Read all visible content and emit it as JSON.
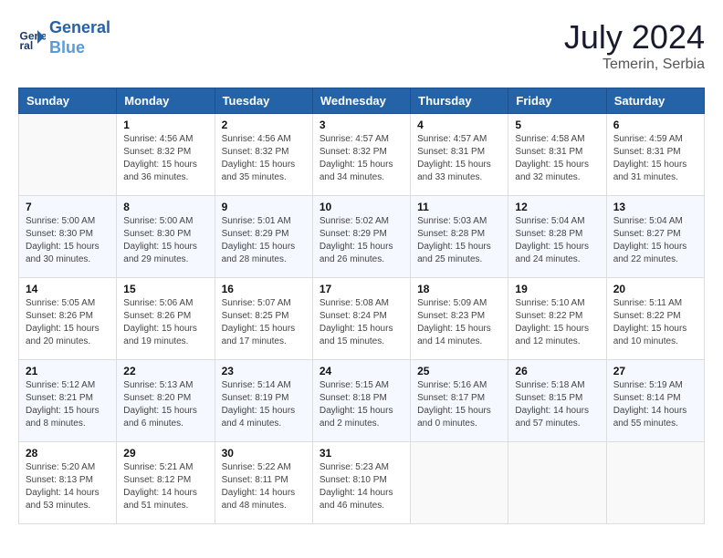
{
  "header": {
    "logo_line1": "General",
    "logo_line2": "Blue",
    "title": "July 2024",
    "subtitle": "Temerin, Serbia"
  },
  "weekdays": [
    "Sunday",
    "Monday",
    "Tuesday",
    "Wednesday",
    "Thursday",
    "Friday",
    "Saturday"
  ],
  "weeks": [
    [
      {
        "day": "",
        "info": ""
      },
      {
        "day": "1",
        "info": "Sunrise: 4:56 AM\nSunset: 8:32 PM\nDaylight: 15 hours\nand 36 minutes."
      },
      {
        "day": "2",
        "info": "Sunrise: 4:56 AM\nSunset: 8:32 PM\nDaylight: 15 hours\nand 35 minutes."
      },
      {
        "day": "3",
        "info": "Sunrise: 4:57 AM\nSunset: 8:32 PM\nDaylight: 15 hours\nand 34 minutes."
      },
      {
        "day": "4",
        "info": "Sunrise: 4:57 AM\nSunset: 8:31 PM\nDaylight: 15 hours\nand 33 minutes."
      },
      {
        "day": "5",
        "info": "Sunrise: 4:58 AM\nSunset: 8:31 PM\nDaylight: 15 hours\nand 32 minutes."
      },
      {
        "day": "6",
        "info": "Sunrise: 4:59 AM\nSunset: 8:31 PM\nDaylight: 15 hours\nand 31 minutes."
      }
    ],
    [
      {
        "day": "7",
        "info": ""
      },
      {
        "day": "8",
        "info": "Sunrise: 5:00 AM\nSunset: 8:30 PM\nDaylight: 15 hours\nand 29 minutes."
      },
      {
        "day": "9",
        "info": "Sunrise: 5:01 AM\nSunset: 8:29 PM\nDaylight: 15 hours\nand 28 minutes."
      },
      {
        "day": "10",
        "info": "Sunrise: 5:02 AM\nSunset: 8:29 PM\nDaylight: 15 hours\nand 26 minutes."
      },
      {
        "day": "11",
        "info": "Sunrise: 5:03 AM\nSunset: 8:28 PM\nDaylight: 15 hours\nand 25 minutes."
      },
      {
        "day": "12",
        "info": "Sunrise: 5:04 AM\nSunset: 8:28 PM\nDaylight: 15 hours\nand 24 minutes."
      },
      {
        "day": "13",
        "info": "Sunrise: 5:04 AM\nSunset: 8:27 PM\nDaylight: 15 hours\nand 22 minutes."
      }
    ],
    [
      {
        "day": "14",
        "info": ""
      },
      {
        "day": "15",
        "info": "Sunrise: 5:06 AM\nSunset: 8:26 PM\nDaylight: 15 hours\nand 19 minutes."
      },
      {
        "day": "16",
        "info": "Sunrise: 5:07 AM\nSunset: 8:25 PM\nDaylight: 15 hours\nand 17 minutes."
      },
      {
        "day": "17",
        "info": "Sunrise: 5:08 AM\nSunset: 8:24 PM\nDaylight: 15 hours\nand 15 minutes."
      },
      {
        "day": "18",
        "info": "Sunrise: 5:09 AM\nSunset: 8:23 PM\nDaylight: 15 hours\nand 14 minutes."
      },
      {
        "day": "19",
        "info": "Sunrise: 5:10 AM\nSunset: 8:22 PM\nDaylight: 15 hours\nand 12 minutes."
      },
      {
        "day": "20",
        "info": "Sunrise: 5:11 AM\nSunset: 8:22 PM\nDaylight: 15 hours\nand 10 minutes."
      }
    ],
    [
      {
        "day": "21",
        "info": ""
      },
      {
        "day": "22",
        "info": "Sunrise: 5:13 AM\nSunset: 8:20 PM\nDaylight: 15 hours\nand 6 minutes."
      },
      {
        "day": "23",
        "info": "Sunrise: 5:14 AM\nSunset: 8:19 PM\nDaylight: 15 hours\nand 4 minutes."
      },
      {
        "day": "24",
        "info": "Sunrise: 5:15 AM\nSunset: 8:18 PM\nDaylight: 15 hours\nand 2 minutes."
      },
      {
        "day": "25",
        "info": "Sunrise: 5:16 AM\nSunset: 8:17 PM\nDaylight: 15 hours\nand 0 minutes."
      },
      {
        "day": "26",
        "info": "Sunrise: 5:18 AM\nSunset: 8:15 PM\nDaylight: 14 hours\nand 57 minutes."
      },
      {
        "day": "27",
        "info": "Sunrise: 5:19 AM\nSunset: 8:14 PM\nDaylight: 14 hours\nand 55 minutes."
      }
    ],
    [
      {
        "day": "28",
        "info": "Sunrise: 5:20 AM\nSunset: 8:13 PM\nDaylight: 14 hours\nand 53 minutes."
      },
      {
        "day": "29",
        "info": "Sunrise: 5:21 AM\nSunset: 8:12 PM\nDaylight: 14 hours\nand 51 minutes."
      },
      {
        "day": "30",
        "info": "Sunrise: 5:22 AM\nSunset: 8:11 PM\nDaylight: 14 hours\nand 48 minutes."
      },
      {
        "day": "31",
        "info": "Sunrise: 5:23 AM\nSunset: 8:10 PM\nDaylight: 14 hours\nand 46 minutes."
      },
      {
        "day": "",
        "info": ""
      },
      {
        "day": "",
        "info": ""
      },
      {
        "day": "",
        "info": ""
      }
    ]
  ],
  "week7_sunday_info": "Sunrise: 5:00 AM\nSunset: 8:30 PM\nDaylight: 15 hours\nand 30 minutes.",
  "week14_sunday_info": "Sunrise: 5:05 AM\nSunset: 8:26 PM\nDaylight: 15 hours\nand 20 minutes.",
  "week21_sunday_info": "Sunrise: 5:12 AM\nSunset: 8:21 PM\nDaylight: 15 hours\nand 8 minutes."
}
